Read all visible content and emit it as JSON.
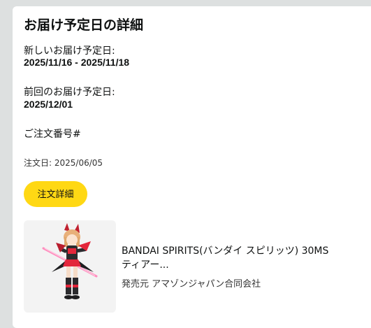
{
  "header": {
    "title": "お届け予定日の詳細"
  },
  "delivery": {
    "new_label": "新しいお届け予定日:",
    "new_value": "2025/11/16 - 2025/11/18",
    "prev_label": "前回のお届け予定日:",
    "prev_value": "2025/12/01"
  },
  "order": {
    "number_label": "ご注文番号#",
    "date_text": "注文日: 2025/06/05",
    "details_button": "注文詳細"
  },
  "product": {
    "title_line1": "BANDAI SPIRITS(バンダイ スピリッツ) 30MS",
    "title_line2": "ティアー...",
    "seller": "発売元 アマゾンジャパン合同会社",
    "image_icon": "figure-product-image"
  },
  "colors": {
    "background": "#dde0e0",
    "button": "#ffd814",
    "figure_accent": "#e3263b",
    "figure_weapon": "#ff7fb0"
  }
}
